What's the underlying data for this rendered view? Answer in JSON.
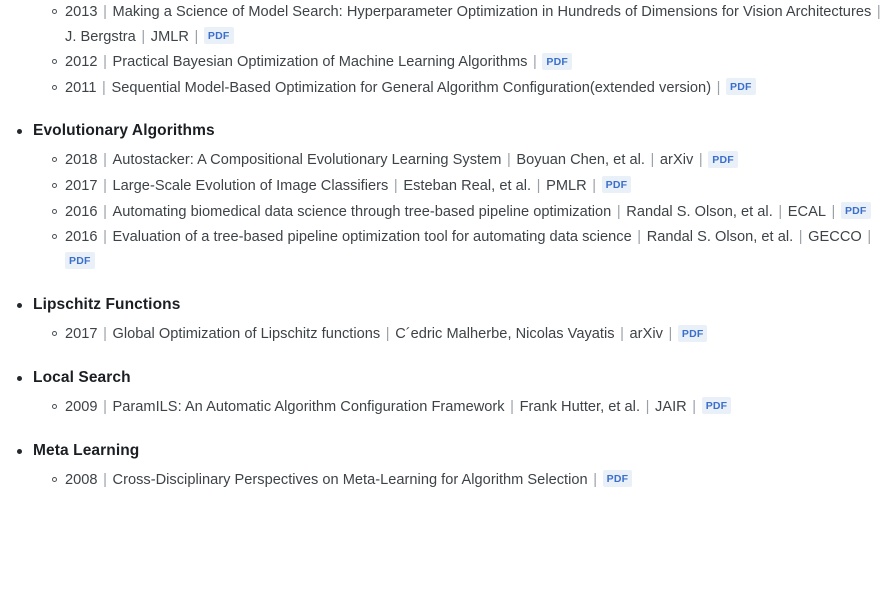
{
  "document": {
    "type": "awesome-list-section",
    "separator": "|",
    "pdf_label": "PDF",
    "orphan_group_note": "continuation of previous category list cut off at top of viewport"
  },
  "orphan_papers": [
    {
      "year": "2013",
      "title": "Making a Science of Model Search: Hyperparameter Optimization in Hundreds of Dimensions for Vision Architectures",
      "authors": "J. Bergstra",
      "venue": "JMLR",
      "pdf": "PDF"
    },
    {
      "year": "2012",
      "title": "Practical Bayesian Optimization of Machine Learning Algorithms",
      "authors": "",
      "venue": "",
      "pdf": "PDF"
    },
    {
      "year": "2011",
      "title": "Sequential Model-Based Optimization for General Algorithm Configuration(extended version)",
      "authors": "",
      "venue": "",
      "pdf": "PDF"
    }
  ],
  "categories": [
    {
      "name": "Evolutionary Algorithms",
      "papers": [
        {
          "year": "2018",
          "title": "Autostacker: A Compositional Evolutionary Learning System",
          "authors": "Boyuan Chen, et al.",
          "venue": "arXiv",
          "pdf": "PDF"
        },
        {
          "year": "2017",
          "title": "Large-Scale Evolution of Image Classifiers",
          "authors": "Esteban Real, et al.",
          "venue": "PMLR",
          "pdf": "PDF"
        },
        {
          "year": "2016",
          "title": "Automating biomedical data science through tree-based pipeline optimization",
          "authors": "Randal S. Olson, et al.",
          "venue": "ECAL",
          "pdf": "PDF"
        },
        {
          "year": "2016",
          "title": "Evaluation of a tree-based pipeline optimization tool for automating data science",
          "authors": "Randal S. Olson, et al.",
          "venue": "GECCO",
          "pdf": "PDF"
        }
      ]
    },
    {
      "name": "Lipschitz Functions",
      "papers": [
        {
          "year": "2017",
          "title": "Global Optimization of Lipschitz functions",
          "authors": "C´edric Malherbe, Nicolas Vayatis",
          "venue": "arXiv",
          "pdf": "PDF"
        }
      ]
    },
    {
      "name": "Local Search",
      "papers": [
        {
          "year": "2009",
          "title": "ParamILS: An Automatic Algorithm Configuration Framework",
          "authors": "Frank Hutter, et al.",
          "venue": "JAIR",
          "pdf": "PDF"
        }
      ]
    },
    {
      "name": "Meta Learning",
      "papers": [
        {
          "year": "2008",
          "title": "Cross-Disciplinary Perspectives on Meta-Learning for Algorithm Selection",
          "authors": "",
          "venue": "",
          "pdf": "PDF"
        }
      ]
    }
  ],
  "colors": {
    "background": "#ffffff",
    "text": "#3d4347",
    "heading": "#1b1f23",
    "separator": "#9aa0a6",
    "badge_bg": "#eaf0f8",
    "badge_text": "#3b6fcc"
  }
}
